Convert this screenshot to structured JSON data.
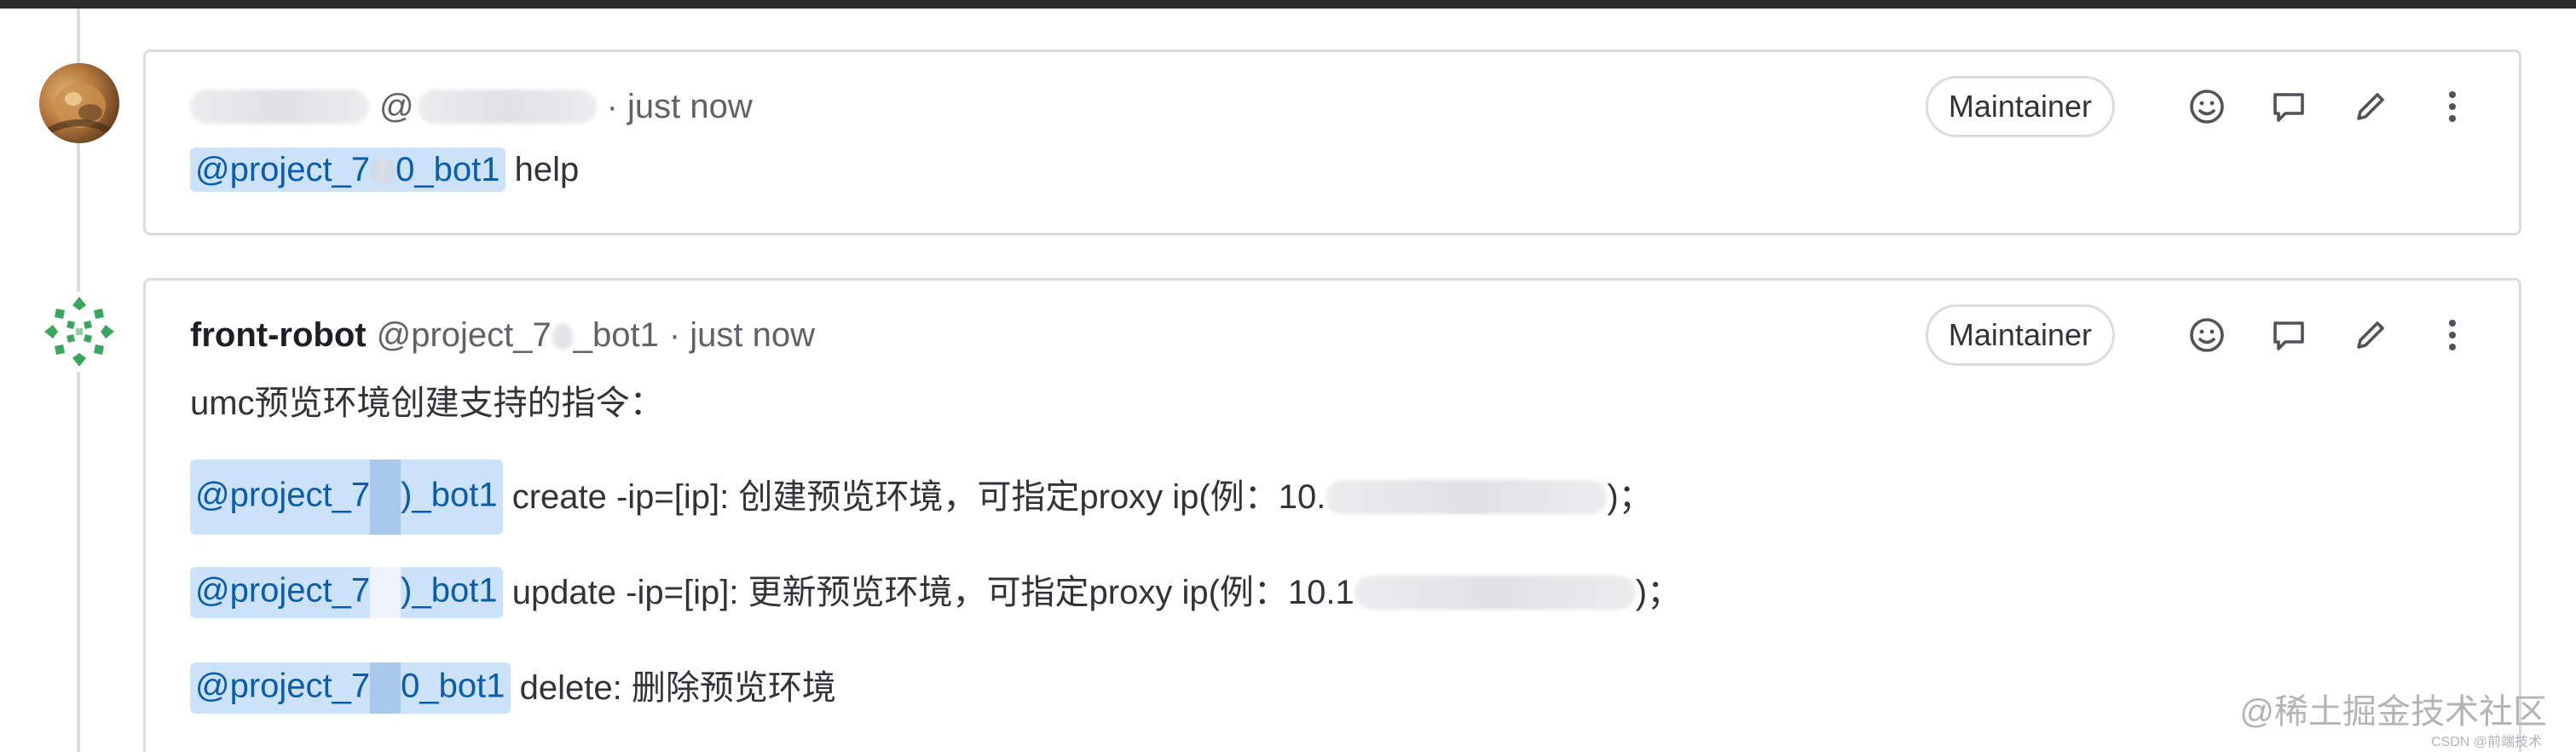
{
  "notes": [
    {
      "author_name": "",
      "username": "@",
      "separator_time": "· just now",
      "role": "Maintainer",
      "body": {
        "mention": "@project_7",
        "mention_tail": "0_bot1",
        "text": " help"
      }
    },
    {
      "author_name": "front-robot",
      "username": "@project_7",
      "username_tail": "_bot1",
      "separator_time": "· just now",
      "role": "Maintainer",
      "intro": "umc预览环境创建支持的指令：",
      "commands": [
        {
          "mention": "@project_7",
          "mention_tail": ")_bot1",
          "text": " create -ip=[ip]: 创建预览环境，可指定proxy ip(例：10.",
          "text_tail": ")；"
        },
        {
          "mention": "@project_7",
          "mention_tail": ")_bot1",
          "text": " update -ip=[ip]: 更新预览环境，可指定proxy ip(例：10.1",
          "text_tail": ")；"
        },
        {
          "mention": "@project_7",
          "mention_tail": "0_bot1",
          "text": " delete: 删除预览环境",
          "text_tail": ""
        }
      ]
    }
  ],
  "watermark": "@稀土掘金技术社区",
  "watermark_sub": "CSDN @前端技术",
  "icons": [
    "smile-icon",
    "comment-icon",
    "pencil-icon",
    "kebab-icon"
  ]
}
